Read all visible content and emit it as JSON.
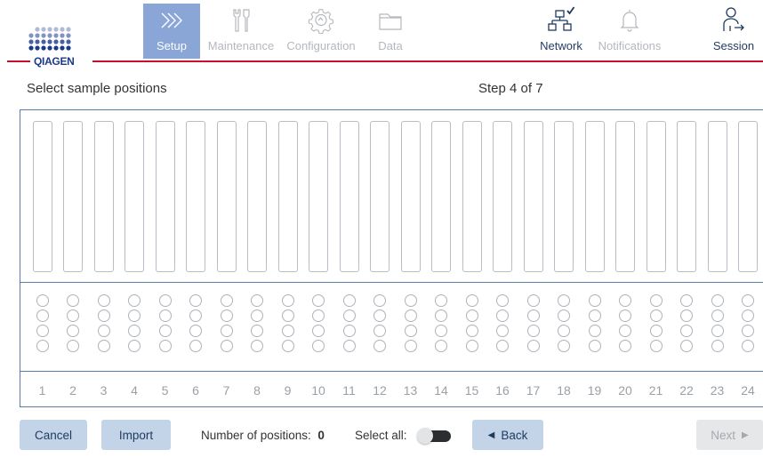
{
  "brand": {
    "name": "QIAGEN",
    "accent": "#c8102e",
    "logo_blue": "#1b3a8c",
    "active_nav": "#8aa6d6"
  },
  "nav": {
    "setup": {
      "label": "Setup",
      "icon": "chevrons-right-icon",
      "active": true
    },
    "maintenance": {
      "label": "Maintenance",
      "icon": "tools-icon"
    },
    "configuration": {
      "label": "Configuration",
      "icon": "gear-icon"
    },
    "data": {
      "label": "Data",
      "icon": "folder-icon"
    },
    "network": {
      "label": "Network",
      "icon": "network-connected-icon"
    },
    "notifications": {
      "label": "Notifications",
      "icon": "bell-icon"
    },
    "session": {
      "label": "Session",
      "icon": "logout-user-icon"
    }
  },
  "page": {
    "title": "Select sample positions",
    "step": "Step 4 of 7"
  },
  "positions": {
    "columns": [
      "1",
      "2",
      "3",
      "4",
      "5",
      "6",
      "7",
      "8",
      "9",
      "10",
      "11",
      "12",
      "13",
      "14",
      "15",
      "16",
      "17",
      "18",
      "19",
      "20",
      "21",
      "22",
      "23",
      "24"
    ],
    "wells_per_column": 4
  },
  "footer": {
    "cancel_label": "Cancel",
    "import_label": "Import",
    "count_label": "Number of positions:",
    "count_value": "0",
    "select_all_label": "Select all:",
    "select_all_on": false,
    "back_label": "Back",
    "next_label": "Next"
  }
}
